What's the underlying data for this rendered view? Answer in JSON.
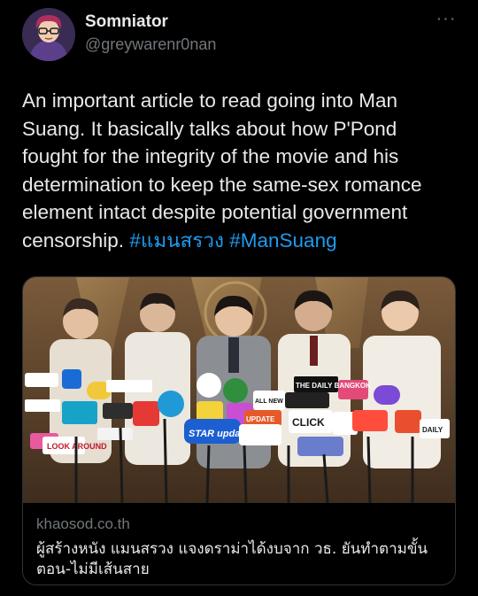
{
  "author": {
    "display_name": "Somniator",
    "handle": "@greywarenr0nan"
  },
  "more_label": "···",
  "tweet": {
    "text": "An important article to read going into Man Suang. It basically talks about how P'Pond fought for the integrity of the movie and his determination to keep the same-sex romance element intact despite potential government censorship. ",
    "hashtags": [
      "#แมนสรวง",
      "#ManSuang"
    ]
  },
  "link_card": {
    "domain": "khaosod.co.th",
    "title": "ผู้สร้างหนัง แมนสรวง แจงดราม่าได้งบจาก วธ. ยันทำตามขั้นตอน-ไม่มีเส้นสาย",
    "image_signage": [
      "LOOK AROUND",
      "THE DAILY BANGKOK",
      "STAR update",
      "ALL NEW",
      "UPDATE",
      "CLICK",
      "DAILY"
    ]
  },
  "colors": {
    "background": "#000000",
    "text_primary": "#e7e9ea",
    "text_secondary": "#71767b",
    "hashtag": "#1d9bf0",
    "card_border": "#2f3336"
  }
}
